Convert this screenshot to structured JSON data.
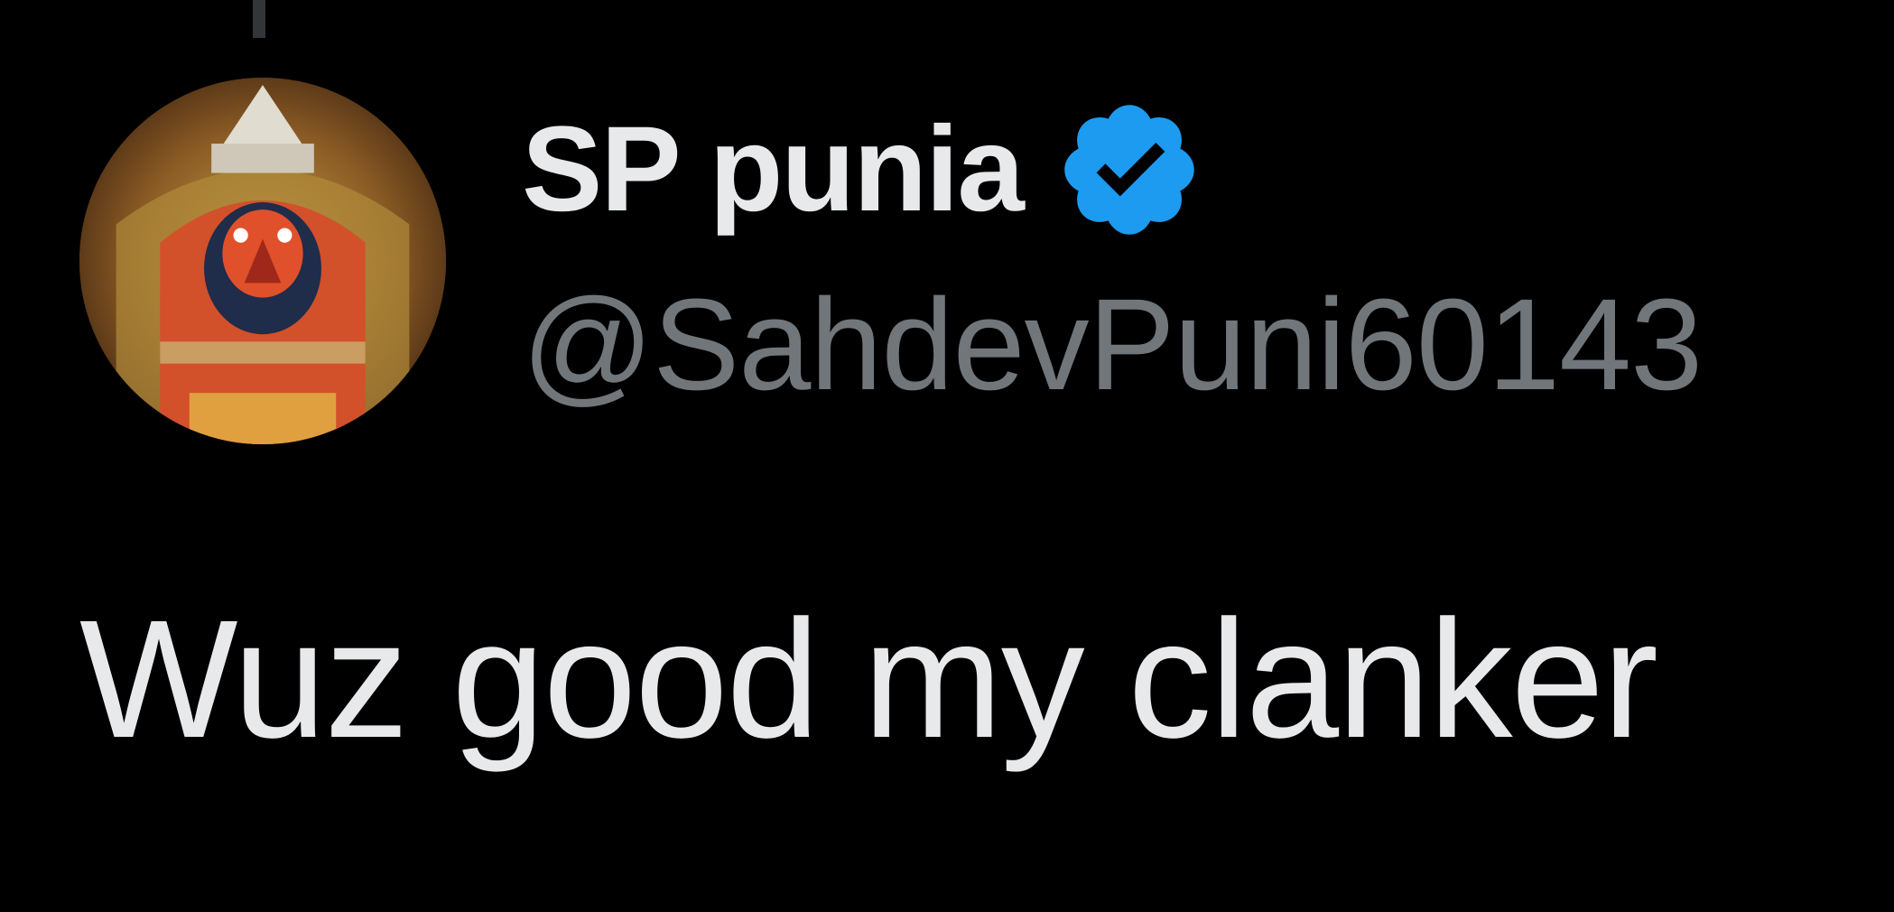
{
  "tweet": {
    "author": {
      "display_name": "SP punia",
      "handle": "@SahdevPuni60143",
      "verified": true,
      "verified_icon": "verified-badge-icon",
      "avatar": "avatar-image"
    },
    "text": "Wuz good my clanker"
  },
  "colors": {
    "background": "#000000",
    "name_text": "#e7e9ea",
    "handle_text": "#71767b",
    "verified_badge": "#1d9bf0",
    "thread_line": "#333639"
  }
}
